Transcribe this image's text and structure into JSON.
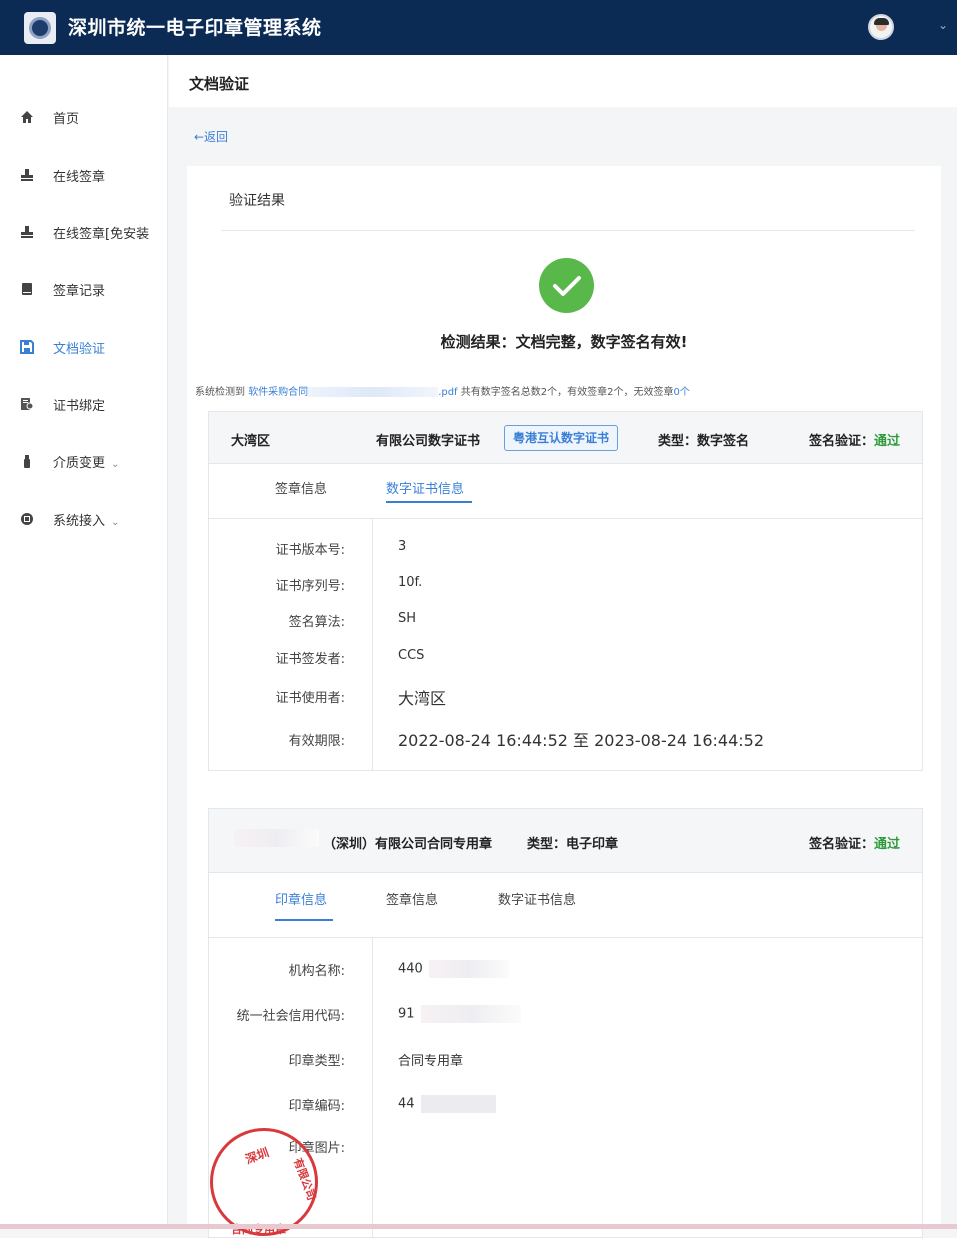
{
  "header": {
    "app_title": "深圳市统一电子印章管理系统",
    "user_caret": "⌄"
  },
  "sidebar": {
    "items": [
      {
        "label": "首页",
        "icon": "home-icon",
        "active": false
      },
      {
        "label": "在线签章",
        "icon": "stamp-icon",
        "active": false
      },
      {
        "label": "在线签章[免安装",
        "icon": "stamp-icon",
        "active": false
      },
      {
        "label": "签章记录",
        "icon": "book-icon",
        "active": false
      },
      {
        "label": "文档验证",
        "icon": "save-icon",
        "active": true
      },
      {
        "label": "证书绑定",
        "icon": "certificate-icon",
        "active": false
      },
      {
        "label": "介质变更",
        "icon": "usb-key-icon",
        "active": false,
        "caret": "⌄"
      },
      {
        "label": "系统接入",
        "icon": "api-icon",
        "active": false,
        "caret": "⌄"
      }
    ]
  },
  "page": {
    "title": "文档验证",
    "back": "←返回"
  },
  "result": {
    "section_title": "验证结果",
    "headline": "检测结果：文档完整，数字签名有效!",
    "summary_prefix": "系统检测到",
    "file_name_start": "软件采购合同",
    "file_ext": ".pdf",
    "summary_total": "共有数字签名总数2个，有效签章2个，无效签章",
    "invalid_count": "0个"
  },
  "signature1": {
    "org_prefix": "大湾区",
    "org_suffix": "有限公司数字证书",
    "tag": "粤港互认数字证书",
    "type": "类型：数字签名",
    "verify_label": "签名验证：",
    "verify_status": "通过",
    "tabs": [
      "签章信息",
      "数字证书信息"
    ],
    "active_tab": 1,
    "fields": [
      {
        "label": "证书版本号:",
        "value": "3"
      },
      {
        "label": "证书序列号:",
        "value": "10f."
      },
      {
        "label": "签名算法:",
        "value": "SH"
      },
      {
        "label": "证书签发者:",
        "value": "CCS"
      },
      {
        "label": "证书使用者:",
        "value": "大湾区"
      },
      {
        "label": "有效期限:",
        "value": "2022-08-24 16:44:52  至  2023-08-24 16:44:52"
      }
    ]
  },
  "signature2": {
    "org": "（深圳）有限公司合同专用章",
    "type": "类型：电子印章",
    "verify_label": "签名验证：",
    "verify_status": "通过",
    "tabs": [
      "印章信息",
      "签章信息",
      "数字证书信息"
    ],
    "active_tab": 0,
    "fields": [
      {
        "label": "机构名称:",
        "value": "440"
      },
      {
        "label": "统一社会信用代码:",
        "value": "91"
      },
      {
        "label": "印章类型:",
        "value": "合同专用章"
      },
      {
        "label": "印章编码:",
        "value": "44"
      },
      {
        "label": "印章图片:",
        "value": ""
      }
    ],
    "seal_text_top": "深圳",
    "seal_text_right": "有限公司",
    "seal_text_bottom": "合同专用章"
  },
  "colors": {
    "header_bg": "#0b2b55",
    "accent": "#3a7fd6",
    "success": "#58b84a",
    "pass_text": "#2e9c3a",
    "seal_red": "#d8393d"
  }
}
